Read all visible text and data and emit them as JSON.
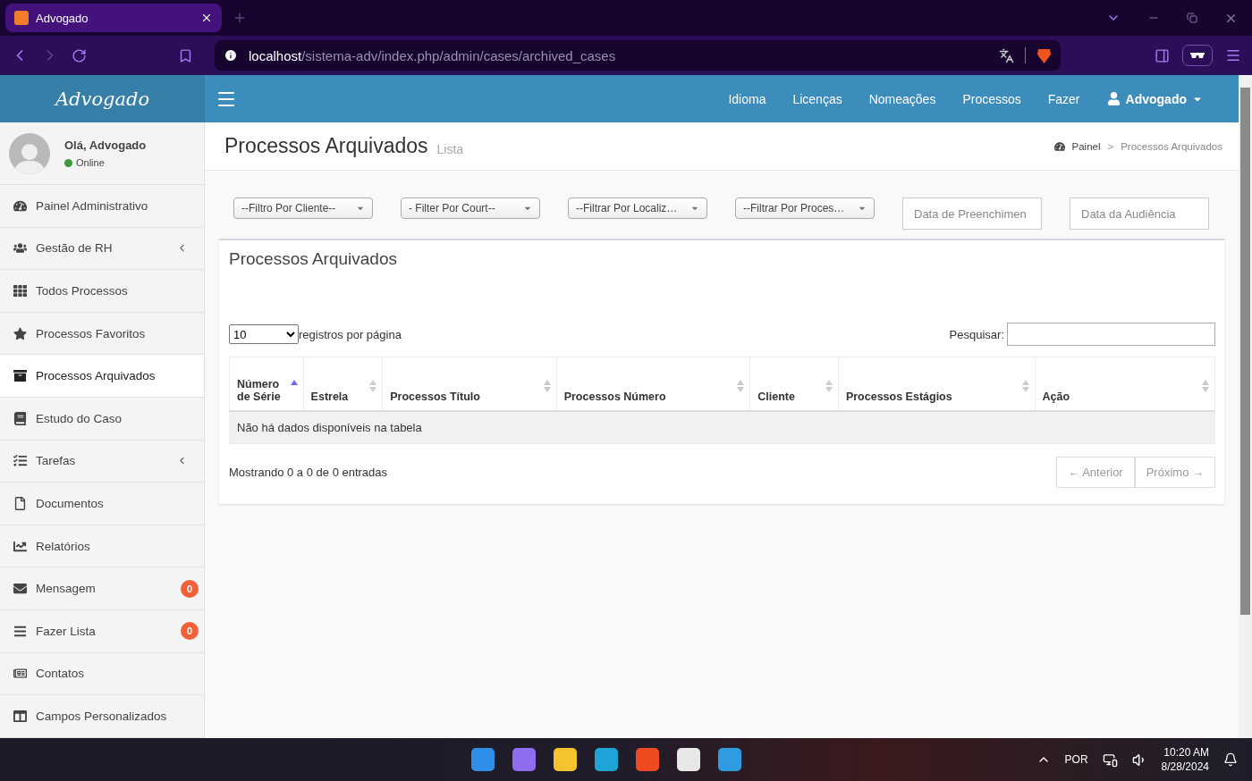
{
  "browser": {
    "tab_title": "Advogado",
    "url_host": "localhost",
    "url_path": "/sistema-adv/index.php/admin/cases/archived_cases"
  },
  "header": {
    "logo": "Advogado",
    "nav": [
      "Idioma",
      "Licenças",
      "Nomeações",
      "Processos",
      "Fazer"
    ],
    "user": "Advogado"
  },
  "sidebar": {
    "greeting": "Olá, Advogado",
    "status": "Online",
    "items": [
      {
        "label": "Painel Administrativo",
        "selected": false,
        "expandable": false
      },
      {
        "label": "Gestão de RH",
        "selected": false,
        "expandable": true
      },
      {
        "label": "Todos Processos",
        "selected": false,
        "expandable": false
      },
      {
        "label": "Processos Favoritos",
        "selected": false,
        "expandable": false
      },
      {
        "label": "Processos Arquivados",
        "selected": true,
        "expandable": false
      },
      {
        "label": "Estudo do Caso",
        "selected": false,
        "expandable": false
      },
      {
        "label": "Tarefas",
        "selected": false,
        "expandable": true
      },
      {
        "label": "Documentos",
        "selected": false,
        "expandable": false
      },
      {
        "label": "Relatórios",
        "selected": false,
        "expandable": false
      },
      {
        "label": "Mensagem",
        "selected": false,
        "expandable": false,
        "badge": "0"
      },
      {
        "label": "Fazer Lista",
        "selected": false,
        "expandable": false,
        "badge": "0"
      },
      {
        "label": "Contatos",
        "selected": false,
        "expandable": false
      },
      {
        "label": "Campos Personalizados",
        "selected": false,
        "expandable": false
      }
    ]
  },
  "page": {
    "title": "Processos Arquivados",
    "subtitle": "Lista",
    "breadcrumb": [
      "Painel",
      "Processos Arquivados"
    ],
    "breadcrumb_separator": ">"
  },
  "filters": [
    {
      "kind": "select",
      "value": "--Filtro Por Cliente--"
    },
    {
      "kind": "select",
      "value": "- Filter Por Court--"
    },
    {
      "kind": "select",
      "value": "--Filtrar Por Localiz…"
    },
    {
      "kind": "select",
      "value": "--Filtrar Por Proces…"
    },
    {
      "kind": "date",
      "placeholder": "Data de Preenchimen"
    },
    {
      "kind": "date",
      "placeholder": "Data da Audiência"
    }
  ],
  "box": {
    "title": "Processos Arquivados",
    "page_length": "10",
    "length_label": "registros por página",
    "search_label": "Pesquisar:",
    "columns": [
      {
        "label": "Número de Série",
        "sorted": true
      },
      {
        "label": "Estrela",
        "sorted": false
      },
      {
        "label": "Processos Título",
        "sorted": false
      },
      {
        "label": "Processos Número",
        "sorted": false
      },
      {
        "label": "Cliente",
        "sorted": false
      },
      {
        "label": "Processos Estágios",
        "sorted": false
      },
      {
        "label": "Ação",
        "sorted": false
      }
    ],
    "empty_message": "Não há dados disponíveis na tabela",
    "info": "Mostrando 0 a 0 de 0 entradas",
    "pagination": [
      {
        "label": "← Anterior",
        "disabled": true
      },
      {
        "label": "Próximo →",
        "disabled": true
      }
    ]
  },
  "taskbar": {
    "language": "POR",
    "time": "10:20 AM",
    "date": "8/28/2024"
  }
}
